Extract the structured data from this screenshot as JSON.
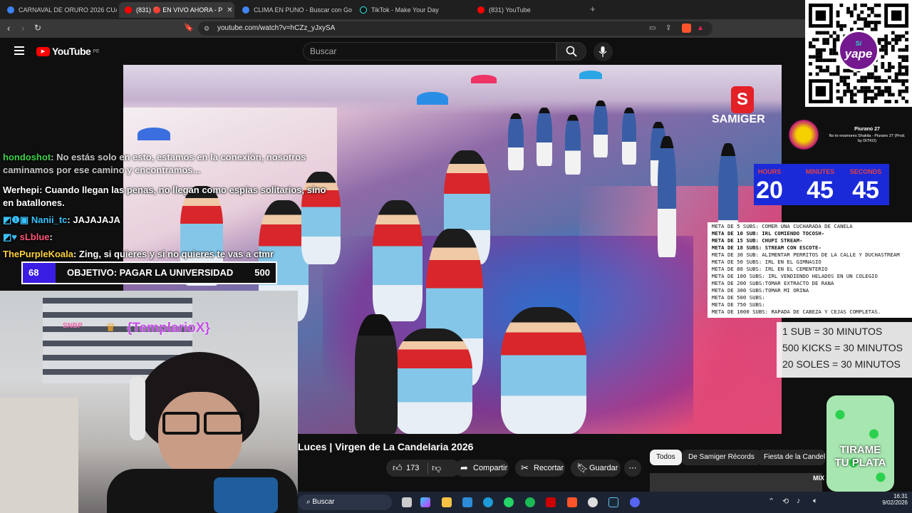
{
  "browser": {
    "tabs": [
      {
        "label": "CARNAVAL DE ORURO 2026 CUANDO",
        "color": "#3b82f6"
      },
      {
        "label": "(831) 🔴 EN VIVO AHORA - P",
        "color": "#ff0000",
        "active": true
      },
      {
        "label": "CLIMA EN PUNO - Buscar con Googl",
        "color": "#4285f4"
      },
      {
        "label": "TikTok - Make Your Day",
        "color": "#25f4ee"
      },
      {
        "label": "(831) YouTube",
        "color": "#ff0000"
      }
    ],
    "url": "youtube.com/watch?v=hCZz_yJxySA"
  },
  "youtube": {
    "logo": "YouTube",
    "region": "PE",
    "search_placeholder": "Buscar"
  },
  "video": {
    "watermark": "SAMIGER",
    "title": "Luces | Virgen de La Candelaria 2026",
    "likes": "173",
    "share_label": "Compartir",
    "clip_label": "Recortar",
    "save_label": "Guardar"
  },
  "chips": [
    "Todos",
    "De Samiger Récords",
    "Fiesta de la Candela"
  ],
  "chat": [
    {
      "user": "hondoshot",
      "user_color": "#3fd14b",
      "text": ": No estás solo en esto, estamos en la conexión, nosotros caminamos por ese camino y encontramos..."
    },
    {
      "user": "Werhepi",
      "user_color": "#ffffff",
      "text": ": Cuando llegan las penas, no llegan como espías solitarios, sino en batallones."
    },
    {
      "user": "Nanii_tc",
      "user_color": "#39c3ff",
      "text": ": JAJAJAJA"
    },
    {
      "user": "sLblue",
      "user_color": "#ff5577",
      "text": ":"
    },
    {
      "user": "ThePurpleKoala",
      "user_color": "#ffd23f",
      "text": ": Zing, si quieres y si no quieres te vas a ctmr"
    }
  ],
  "goal": {
    "current": "68",
    "text": "OBJETIVO: PAGAR LA UNIVERSIDAD",
    "target": "500",
    "progress": 0.136
  },
  "webcam": {
    "alert_user": "{TemplarioX}"
  },
  "music": {
    "artist": "Piurano 27",
    "song": "No te enamores Shakita - Piurano 27 (Prod. by DITKO)"
  },
  "timer": {
    "labels": [
      "HOURS",
      "MINUTES",
      "SECONDS"
    ],
    "values": [
      "20",
      "45",
      "45"
    ]
  },
  "metas": [
    "META DE 5 SUBS: COMER UNA CUCHARADA DE CANELA",
    "META DE 10 SUB: IRL COMIENDO TOCOSH-",
    "META DE 15 SUB: CHUPI STREAM-",
    "META DE 18 SUBS: STREAM CON ESCOTE-",
    "META DE 30 SUB:  ALIMENTAR PERRITOS DE LA CALLE Y DUCHASTREAM",
    "META DE 50 SUBS: IRL EN EL GIMNASIO",
    "META DE 80 SUBS: IRL EN EL CEMENTERIO",
    "META DE 100 SUBS: IRL VENDIENDO HELADOS EN UN COLEGIO",
    "META DE 200 SUBS:TOMAR EXTRACTO DE RANA",
    "META DE 300 SUBS:TOMAR MI ORINA",
    "META DE 500 SUBS:",
    "META DE 750 SUBS:",
    "META DE 1000 SUBS: RAPADA DE CABEZA Y CEJAS COMPLETAS."
  ],
  "subs_rates": [
    "1 SUB = 30 MINUTOS",
    "500 KICKS = 30 MINUTOS",
    "20 SOLES = 30 MINUTOS"
  ],
  "qr": {
    "brand": "yape",
    "symbol": "S/"
  },
  "jar": {
    "text1": "TIRAME",
    "text2": "TU PLATA"
  },
  "taskbar": {
    "search": "Buscar",
    "time": "16:31",
    "date": "9/02/2026",
    "side_text": "MIX"
  }
}
